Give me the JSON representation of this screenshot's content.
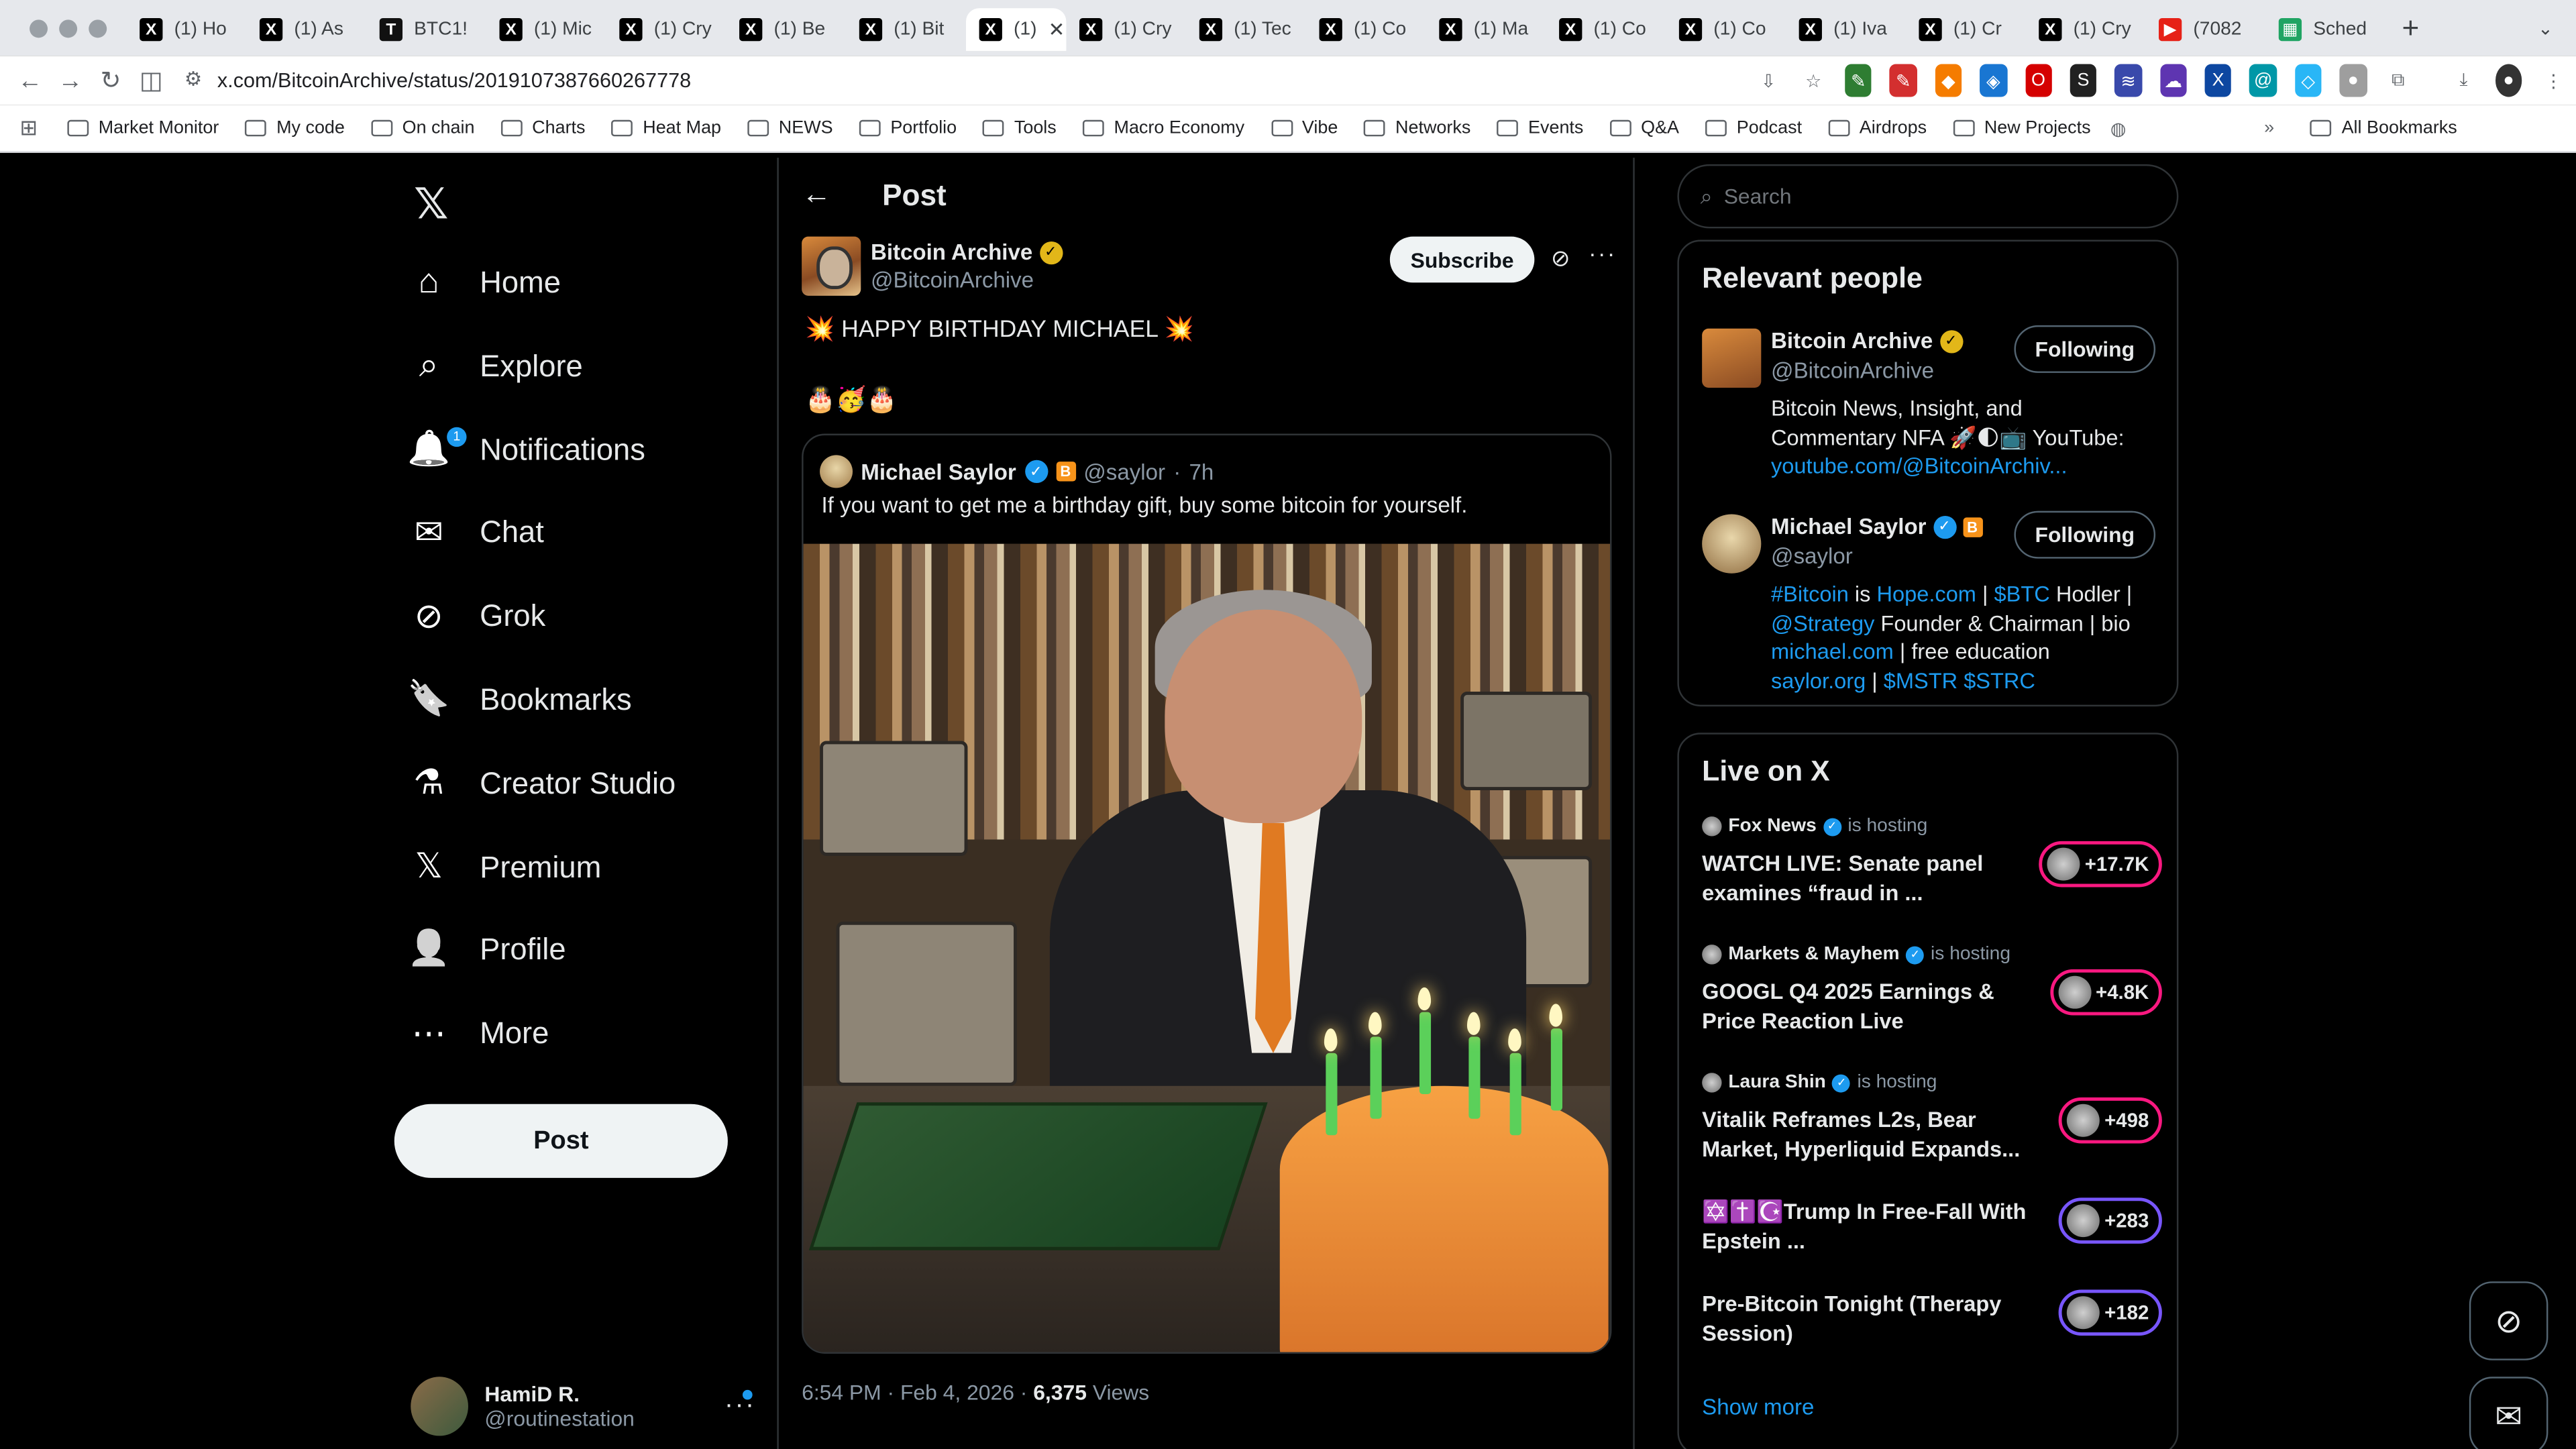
{
  "browser": {
    "tabs": [
      {
        "title": "(1) Ho",
        "icon": "x-favicon"
      },
      {
        "title": "(1) As",
        "icon": "x-favicon"
      },
      {
        "title": "BTC1!",
        "icon": "tradingview-favicon"
      },
      {
        "title": "(1) Mic",
        "icon": "x-favicon"
      },
      {
        "title": "(1) Cry",
        "icon": "x-favicon"
      },
      {
        "title": "(1) Be",
        "icon": "x-favicon"
      },
      {
        "title": "(1) Bit",
        "icon": "x-favicon"
      },
      {
        "title": "(1)",
        "icon": "x-favicon",
        "active": true
      },
      {
        "title": "(1) Cry",
        "icon": "x-favicon"
      },
      {
        "title": "(1) Tec",
        "icon": "x-favicon"
      },
      {
        "title": "(1) Co",
        "icon": "x-favicon"
      },
      {
        "title": "(1) Ma",
        "icon": "x-favicon"
      },
      {
        "title": "(1) Co",
        "icon": "x-favicon"
      },
      {
        "title": "(1) Co",
        "icon": "x-favicon"
      },
      {
        "title": "(1) Iva",
        "icon": "x-favicon"
      },
      {
        "title": "(1) Cr",
        "icon": "x-favicon"
      },
      {
        "title": "(1) Cry",
        "icon": "x-favicon"
      },
      {
        "title": "(7082",
        "icon": "youtube-favicon"
      },
      {
        "title": "Sched",
        "icon": "sheets-favicon"
      }
    ],
    "new_tab": "+",
    "url": "x.com/BitcoinArchive/status/2019107387660267778",
    "bookmarks": [
      "Market Monitor",
      "My code",
      "On chain",
      "Charts",
      "Heat Map",
      "NEWS",
      "Portfolio",
      "Tools",
      "Macro Economy",
      "Vibe",
      "Networks",
      "Events",
      "Q&A",
      "Podcast",
      "Airdrops",
      "New Projects"
    ],
    "all_bookmarks": "All Bookmarks",
    "more_bookmarks": "»"
  },
  "nav": {
    "items": [
      {
        "label": "Home",
        "icon": "home-icon"
      },
      {
        "label": "Explore",
        "icon": "search-icon"
      },
      {
        "label": "Notifications",
        "icon": "bell-icon",
        "badge": "1"
      },
      {
        "label": "Chat",
        "icon": "mail-icon"
      },
      {
        "label": "Grok",
        "icon": "grok-icon"
      },
      {
        "label": "Bookmarks",
        "icon": "bookmark-icon"
      },
      {
        "label": "Creator Studio",
        "icon": "flask-icon"
      },
      {
        "label": "Premium",
        "icon": "x-premium-icon"
      },
      {
        "label": "Profile",
        "icon": "person-icon"
      },
      {
        "label": "More",
        "icon": "more-circle-icon"
      }
    ],
    "post_button": "Post",
    "account": {
      "name": "HamiD R.",
      "handle": "@routinestation"
    }
  },
  "post": {
    "header": "Post",
    "author": {
      "name": "Bitcoin Archive",
      "handle": "@BitcoinArchive"
    },
    "subscribe": "Subscribe",
    "text": "💥 HAPPY BIRTHDAY MICHAEL 💥",
    "emojis": "🎂🥳🎂",
    "quote": {
      "name": "Michael Saylor",
      "handle": "@saylor",
      "time": "7h",
      "text": "If you want to get me a birthday gift, buy some bitcoin for yourself."
    },
    "timestamp": "6:54 PM · Feb 4, 2026 ·",
    "views_count": "6,375",
    "views_label": "Views"
  },
  "right": {
    "search_placeholder": "Search",
    "relevant_title": "Relevant people",
    "people": [
      {
        "name": "Bitcoin Archive",
        "handle": "@BitcoinArchive",
        "button": "Following",
        "bio_line1": "Bitcoin News, Insight, and",
        "bio_line2": "Commentary NFA 🚀🌓📺 YouTube:",
        "bio_link": "youtube.com/@BitcoinArchiv..."
      },
      {
        "name": "Michael Saylor",
        "handle": "@saylor",
        "button": "Following",
        "bio": {
          "hashtag": "#Bitcoin",
          "is": " is ",
          "hope": "Hope.com",
          "sep1": " | ",
          "btc": "$BTC",
          "hodler": " Hodler |",
          "strategy": "@Strategy",
          "founder": " Founder & Chairman | bio",
          "michael": "michael.com",
          "free": " | free education",
          "saylor": "saylor.org",
          "sep2": " | ",
          "tickers": "$MSTR $STRC"
        }
      }
    ],
    "live_title": "Live on X",
    "live": [
      {
        "host": "Fox News",
        "is": "is hosting",
        "title": "WATCH LIVE: Senate panel examines “fraud in ...",
        "count": "+17.7K",
        "pill": "pink"
      },
      {
        "host": "Markets & Mayhem",
        "is": "is hosting",
        "title": "GOOGL Q4 2025 Earnings & Price Reaction Live",
        "count": "+4.8K",
        "pill": "pink"
      },
      {
        "host": "Laura Shin",
        "is": "is hosting",
        "title": "Vitalik Reframes L2s, Bear Market, Hyperliquid Expands...",
        "count": "+498",
        "pill": "pink"
      },
      {
        "host": "",
        "is": "",
        "title": "✡️✝️☪️Trump In Free-Fall With Epstein ...",
        "count": "+283",
        "pill": "purple"
      },
      {
        "host": "",
        "is": "",
        "title": "Pre-Bitcoin Tonight (Therapy Session)",
        "count": "+182",
        "pill": "purple"
      }
    ],
    "show_more": "Show more"
  },
  "colors": {
    "accent": "#1d9bf0",
    "background": "#000000",
    "live_pink": "#f91880",
    "live_purple": "#7856ff",
    "gold_check": "#e2b719"
  }
}
